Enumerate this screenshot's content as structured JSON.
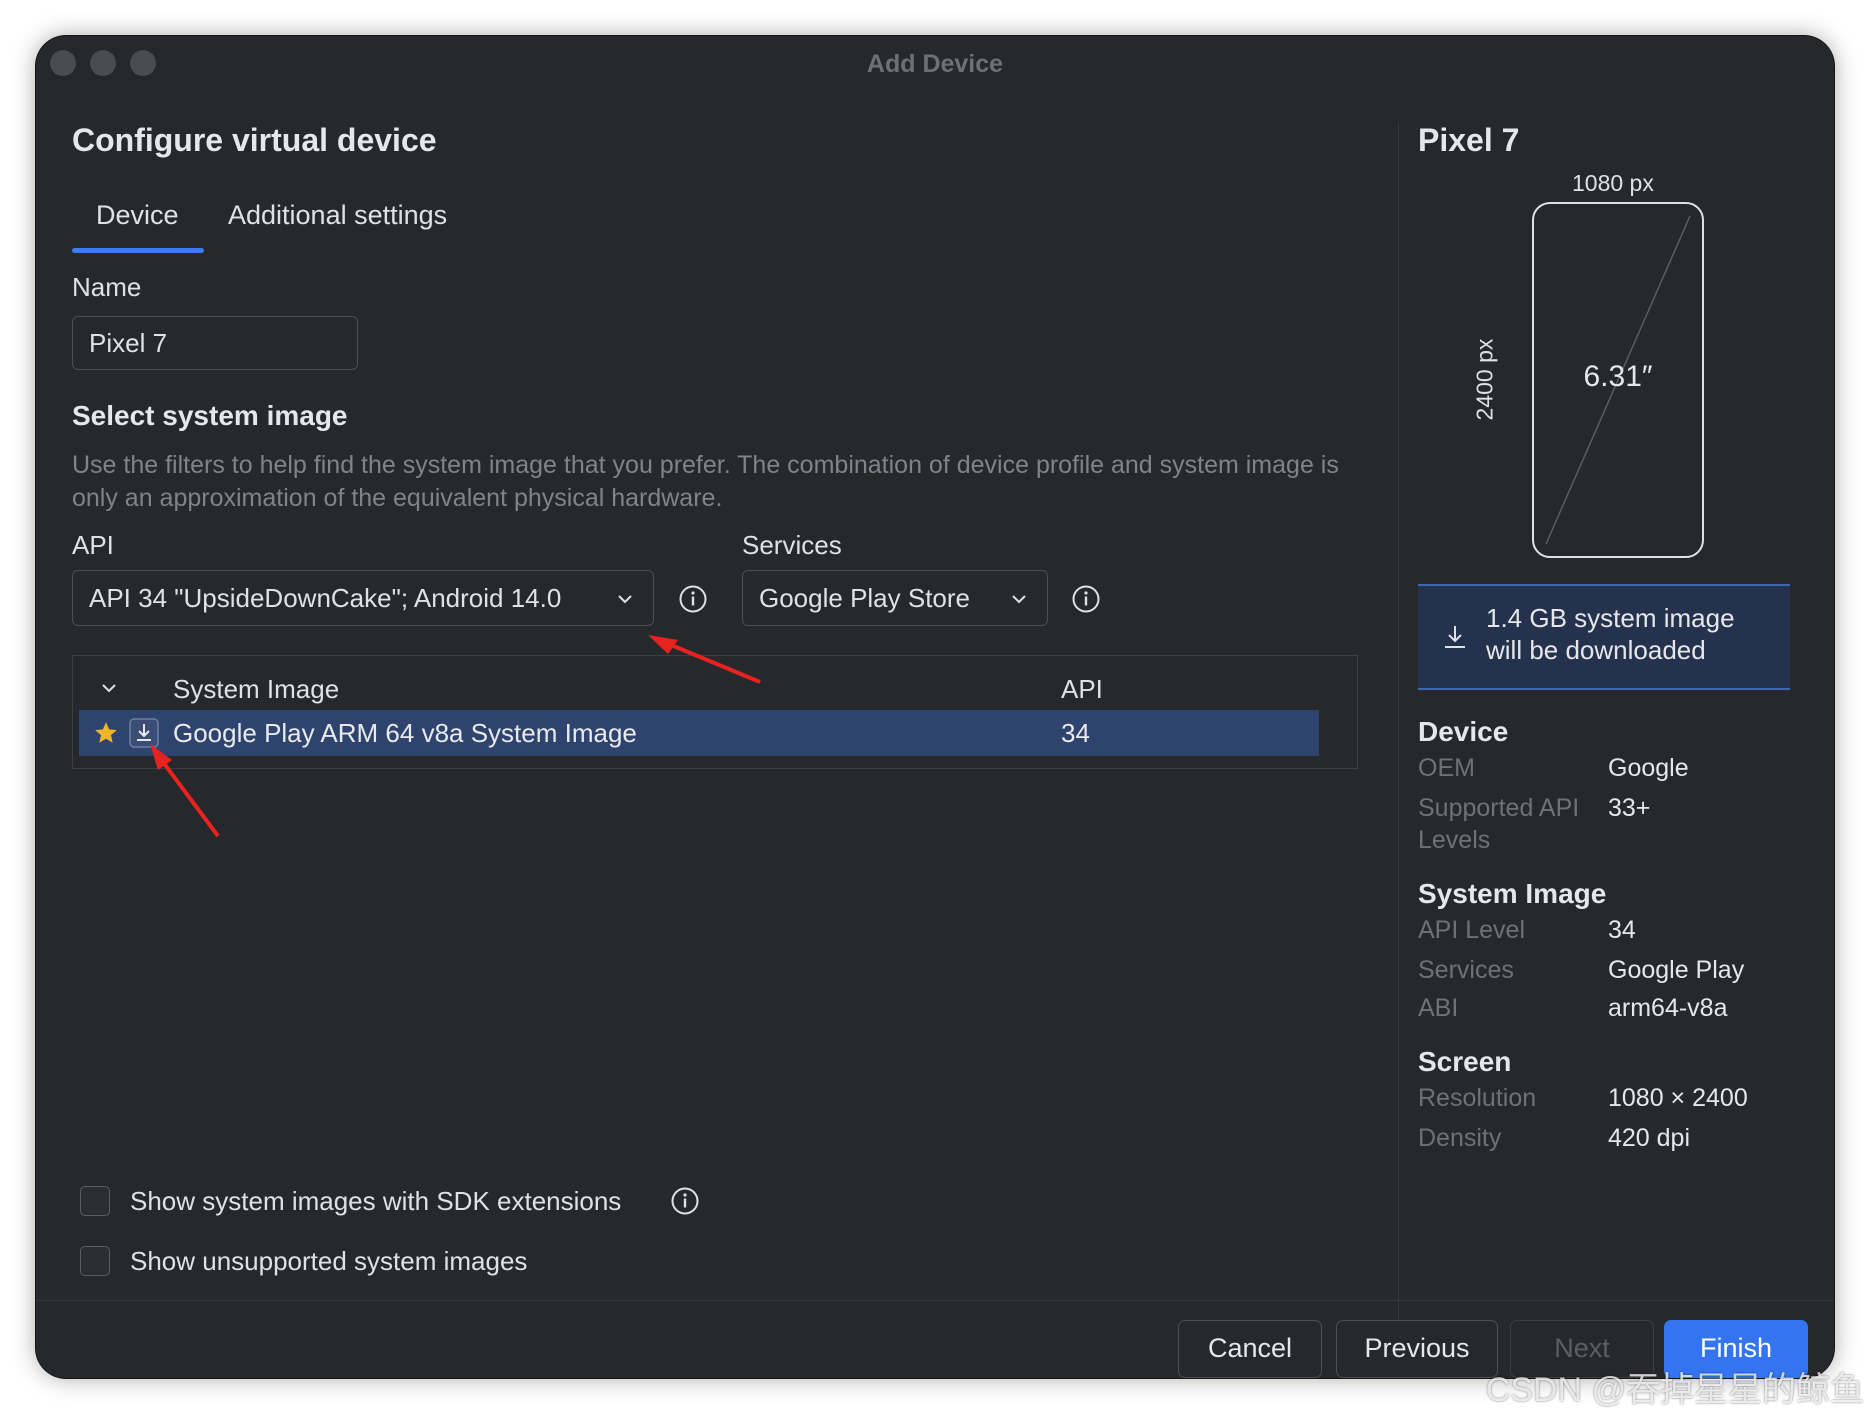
{
  "window": {
    "title": "Add Device"
  },
  "page": {
    "heading": "Configure virtual device"
  },
  "tabs": [
    {
      "label": "Device"
    },
    {
      "label": "Additional settings"
    }
  ],
  "name_field": {
    "label": "Name",
    "value": "Pixel 7"
  },
  "system_image": {
    "heading": "Select system image",
    "description": "Use the filters to help find the system image that you prefer. The combination of device profile and system image is only an approximation of the equivalent physical hardware.",
    "api_label": "API",
    "api_value": "API 34 \"UpsideDownCake\"; Android 14.0",
    "services_label": "Services",
    "services_value": "Google Play Store",
    "table": {
      "columns": [
        "System Image",
        "API"
      ],
      "rows": [
        {
          "name": "Google Play ARM 64 v8a System Image",
          "api": "34"
        }
      ]
    },
    "show_sdk_extensions": "Show system images with SDK extensions",
    "show_unsupported": "Show unsupported system images"
  },
  "buttons": {
    "cancel": "Cancel",
    "previous": "Previous",
    "next": "Next",
    "finish": "Finish"
  },
  "preview": {
    "device_name": "Pixel 7",
    "width_label": "1080 px",
    "height_label": "2400 px",
    "diagonal": "6.31″",
    "download_notice": "1.4 GB system image will be downloaded"
  },
  "details": {
    "device": {
      "heading": "Device",
      "oem_key": "OEM",
      "oem_value": "Google",
      "api_levels_key": "Supported API Levels",
      "api_levels_value": "33+"
    },
    "system_image": {
      "heading": "System Image",
      "api_level_key": "API Level",
      "api_level_value": "34",
      "services_key": "Services",
      "services_value": "Google Play",
      "abi_key": "ABI",
      "abi_value": "arm64-v8a"
    },
    "screen": {
      "heading": "Screen",
      "resolution_key": "Resolution",
      "resolution_value": "1080 × 2400",
      "density_key": "Density",
      "density_value": "420 dpi"
    }
  },
  "watermark": "CSDN @吞掉星星的鲸鱼",
  "colors": {
    "accent": "#3574f0",
    "selection": "#2e436e",
    "background": "#26282b",
    "annotation_arrow": "#e8231f"
  },
  "icons": [
    "star-icon",
    "download-icon",
    "info-icon",
    "chevron-down-icon"
  ]
}
